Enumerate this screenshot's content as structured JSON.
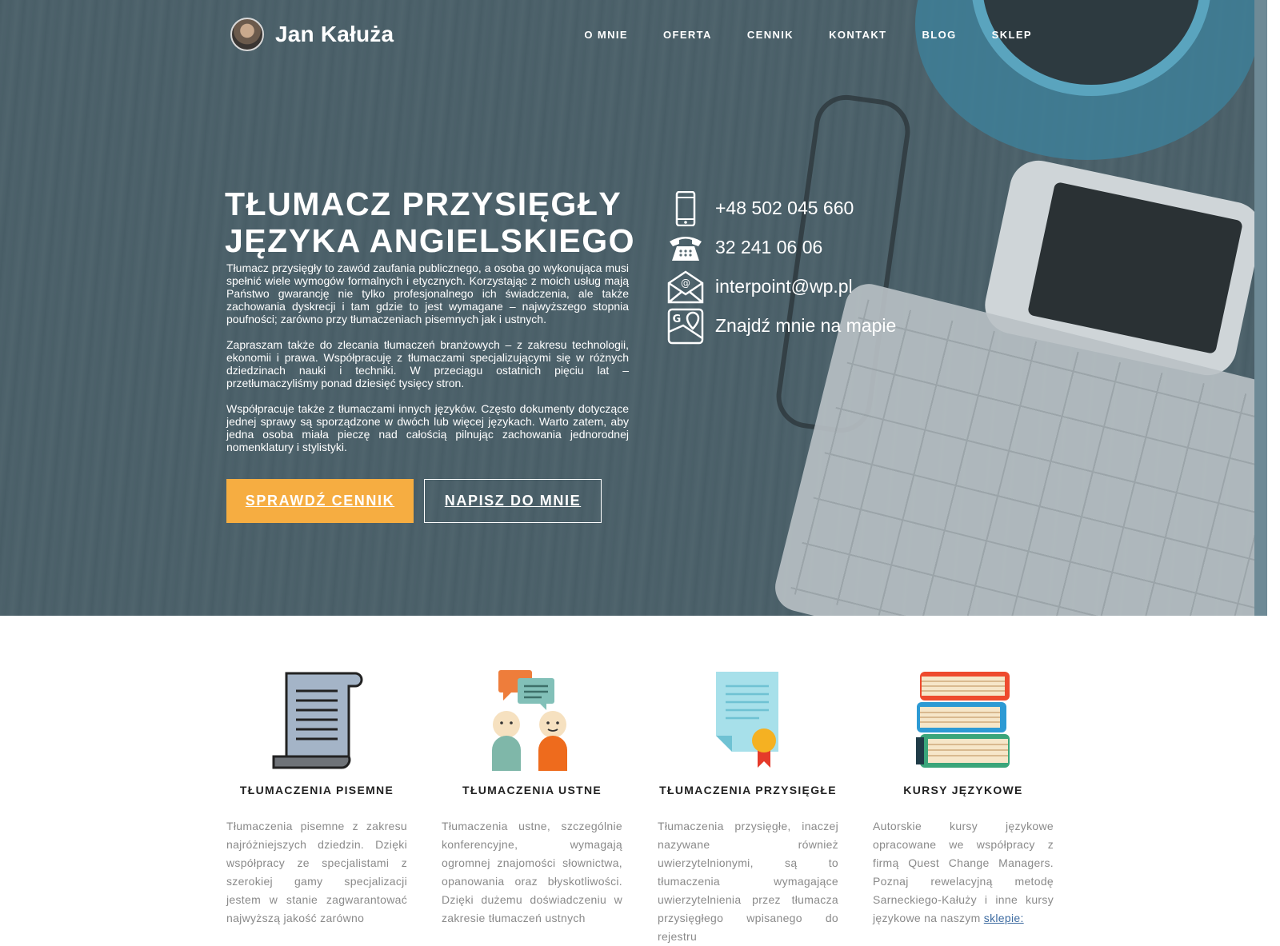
{
  "header": {
    "brand_name": "Jan Kałuża",
    "nav": [
      "O MNIE",
      "OFERTA",
      "CENNIK",
      "KONTAKT",
      "BLOG",
      "SKLEP"
    ]
  },
  "hero": {
    "title_line1": "TŁUMACZ PRZYSIĘGŁY",
    "title_line2": "JĘZYKA ANGIELSKIEGO",
    "paragraphs": [
      "Tłumacz przysięgły to zawód zaufania publicznego, a osoba go wykonująca musi spełnić wiele wymogów formalnych i etycznych. Korzystając z moich usług mają Państwo gwarancję nie tylko profesjonalnego ich świadczenia, ale także zachowania dyskrecji i tam gdzie to jest wymagane – najwyższego stopnia poufności; zarówno przy tłumaczeniach pisemnych jak i ustnych.",
      "Zapraszam także do zlecania tłumaczeń branżowych – z zakresu technologii, ekonomii i prawa. Współpracuję z tłumaczami specjalizującymi się w różnych dziedzinach nauki i techniki. W przeciągu ostatnich pięciu lat – przetłumaczyliśmy ponad dziesięć tysięcy stron.",
      "Współpracuje także z tłumaczami innych języków. Często dokumenty dotyczące jednej sprawy są sporządzone w dwóch lub więcej językach. Warto zatem, aby jedna osoba miała pieczę nad całością pilnując zachowania jednorodnej nomenklatury i stylistyki."
    ],
    "btn_price": "SPRAWDŹ CENNIK",
    "btn_write": "NAPISZ DO MNIE",
    "accent_color": "#f6ad41"
  },
  "contacts": {
    "phone": "+48 502 045 660",
    "landline": "32 241 06 06",
    "email": "interpoint@wp.pl",
    "map": "Znajdź mnie na mapie"
  },
  "services": [
    {
      "icon": "scroll-icon",
      "title": "TŁUMACZENIA PISEMNE",
      "text": "Tłumaczenia pisemne z zakresu najróżniejszych dziedzin. Dzięki współpracy ze specjalistami z szerokiej gamy specjalizacji jestem w stanie zagwarantować najwyższą jakość zarówno"
    },
    {
      "icon": "people-chat-icon",
      "title": "TŁUMACZENIA USTNE",
      "text": "Tłumaczenia ustne, szczególnie konferencyjne, wymagają ogromnej znajomości słownictwa, opanowania oraz błyskotliwości. Dzięki dużemu doświadczeniu w zakresie tłumaczeń ustnych"
    },
    {
      "icon": "certificate-icon",
      "title": "TŁUMACZENIA PRZYSIĘGŁE",
      "text": "Tłumaczenia przysięgłe, inaczej nazywane również uwierzytelnionymi, są to tłumaczenia wymagające uwierzytelnienia przez tłumacza przysięgłego wpisanego do rejestru"
    },
    {
      "icon": "books-icon",
      "title": "KURSY JĘZYKOWE",
      "text": "Autorskie kursy językowe opracowane we współpracy z firmą Quest Change Managers. Poznaj rewelacyjną metodę Sarneckiego-Kałuży i inne kursy językowe na naszym",
      "link": "sklepie:"
    }
  ]
}
